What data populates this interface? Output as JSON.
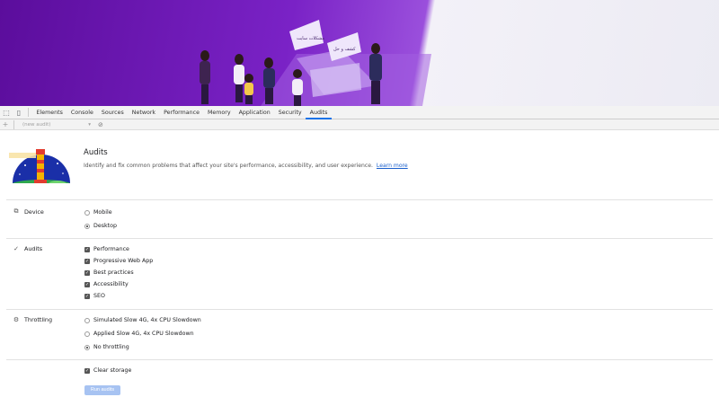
{
  "tabs": [
    "Elements",
    "Console",
    "Sources",
    "Network",
    "Performance",
    "Memory",
    "Application",
    "Security",
    "Audits"
  ],
  "active_tab": "Audits",
  "toolbar": {
    "audit_select": "(new audit)"
  },
  "panel": {
    "title": "Audits",
    "description": "Identify and fix common problems that affect your site's performance, accessibility, and user experience.",
    "learn_more": "Learn more"
  },
  "hero": {
    "bubble_left": "ﻣﺸﮑﻼﺕ ﺳﺎﯾﺖ",
    "bubble_right": "ﮐﺸﻒ ﻭ ﺣﻞ"
  },
  "device": {
    "label": "Device",
    "options": [
      "Mobile",
      "Desktop"
    ],
    "selected": "Desktop"
  },
  "audits": {
    "label": "Audits",
    "options": [
      "Performance",
      "Progressive Web App",
      "Best practices",
      "Accessibility",
      "SEO"
    ]
  },
  "throttling": {
    "label": "Throttling",
    "options": [
      "Simulated Slow 4G, 4x CPU Slowdown",
      "Applied Slow 4G, 4x CPU Slowdown",
      "No throttling"
    ],
    "selected": "No throttling"
  },
  "clear_storage": "Clear storage",
  "run_button": "Run audits",
  "colors": {
    "accent": "#1a73e8",
    "run_button": "#a7c3f2",
    "link": "#1a5fcc",
    "hero_purple": "#7a22c6"
  }
}
